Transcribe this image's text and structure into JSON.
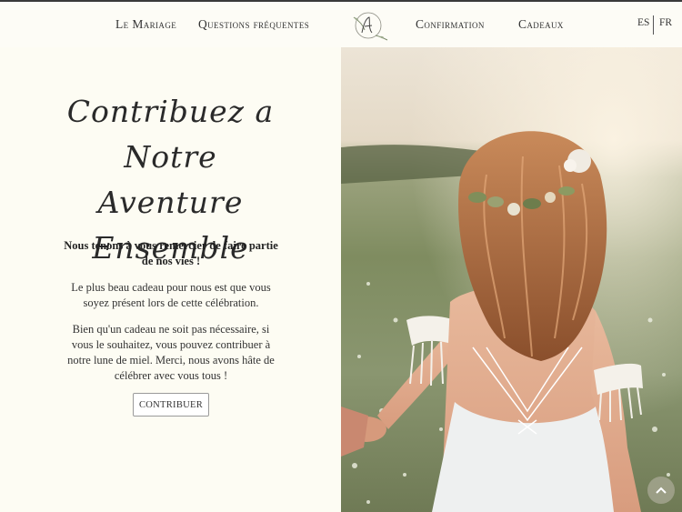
{
  "nav": {
    "items": [
      "Le Mariage",
      "Questions fréquentes",
      "Confirmation",
      "Cadeaux"
    ],
    "lang": {
      "es": "ES",
      "fr": "FR"
    }
  },
  "main": {
    "title_lines": [
      "Contribuez a",
      "Notre Aventure",
      "Ensemble"
    ],
    "lead": "Nous tenons à vous remercier de faire partie de nos vies !",
    "para1": "Le plus beau cadeau pour nous est que vous soyez présent lors de cette célébration.",
    "para2": "Bien qu'un cadeau ne soit pas nécessaire, si vous le souhaitez, vous pouvez contribuer à notre lune de miel. Merci, nous avons hâte de célébrer avec vous tous !",
    "button": "CONTRIBUER"
  },
  "icons": {
    "logo": "monogram-logo",
    "scroll": "chevron-up-icon"
  },
  "colors": {
    "background": "#fdfcf3",
    "text": "#2b2b2b"
  }
}
